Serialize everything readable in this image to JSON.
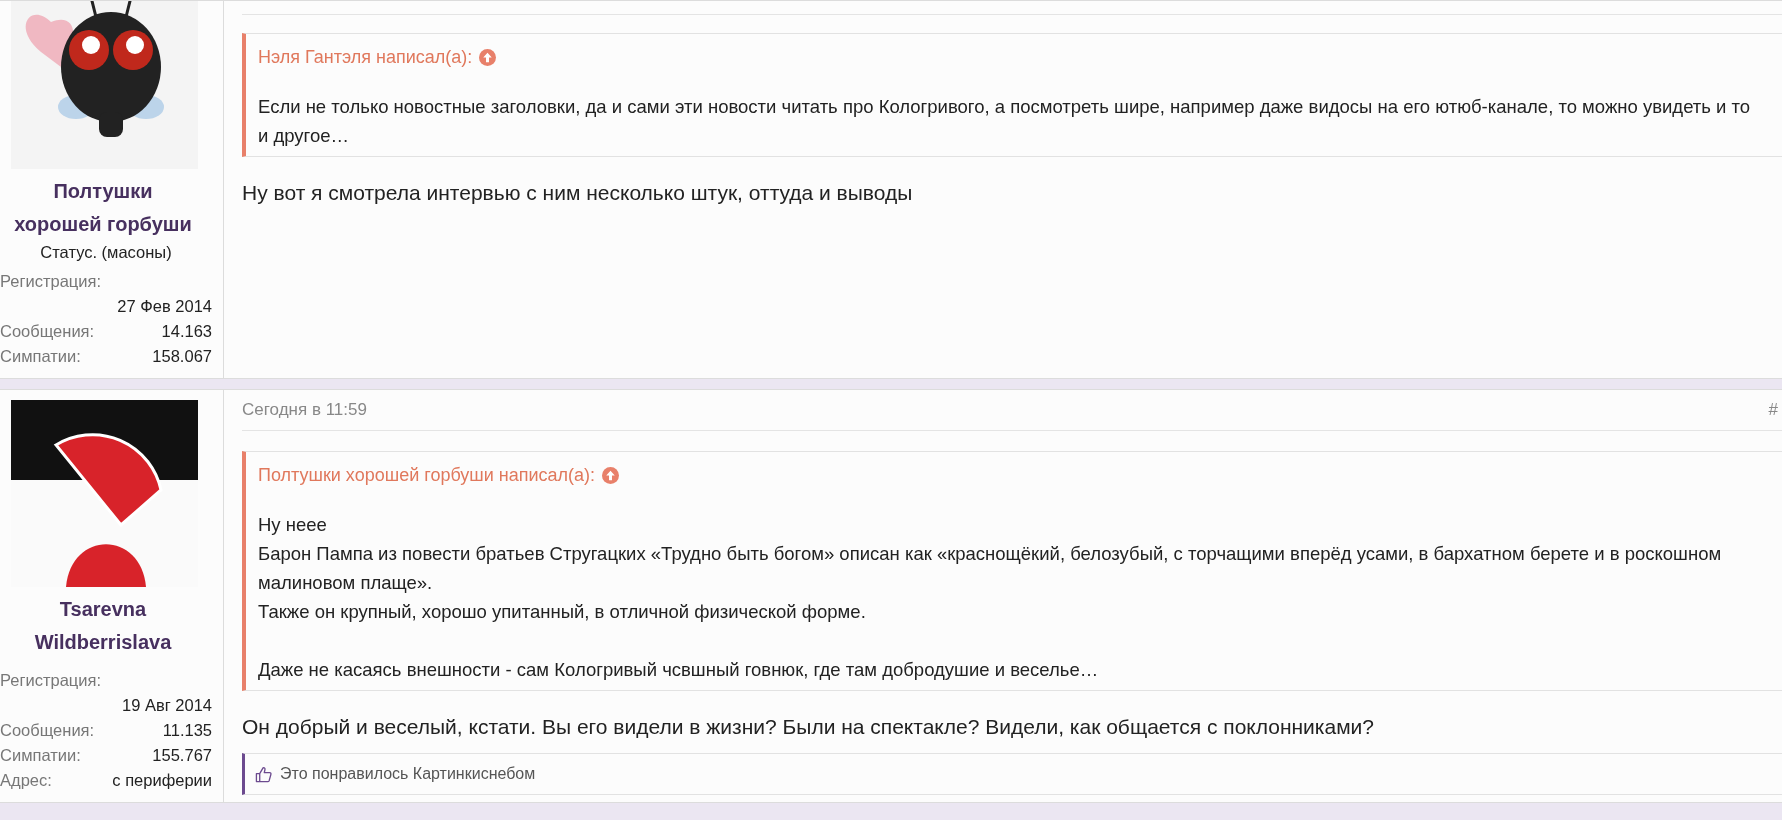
{
  "posts": [
    {
      "author": {
        "name": "Полтушки хорошей горбуши",
        "status": "Статус. (масоны)",
        "avatar": {
          "kind": "insect"
        },
        "stats": [
          {
            "label": "Регистрация:",
            "value": "27 Фев 2014",
            "kind": "stacked"
          },
          {
            "label": "Сообщения:",
            "value": "14.163",
            "kind": "inline"
          },
          {
            "label": "Симпатии:",
            "value": "158.067",
            "kind": "inline"
          }
        ]
      },
      "quote": {
        "author_line": "Нэля Гантэля написал(а):",
        "paragraphs": [
          [
            "Если не только новостные заголовки, да и сами эти новости читать про Кологривого, а посмотреть шире, например даже видосы на его ютюб-канале, то можно увидеть и то и другое…"
          ]
        ]
      },
      "body": "Ну вот я смотрела интервью с ним несколько штук, оттуда и выводы"
    },
    {
      "author": {
        "name": "Tsarevna Wildberrislava",
        "avatar": {
          "kind": "illustration"
        },
        "stats": [
          {
            "label": "Регистрация:",
            "value": "19 Авг 2014",
            "kind": "stacked"
          },
          {
            "label": "Сообщения:",
            "value": "11.135",
            "kind": "inline"
          },
          {
            "label": "Симпатии:",
            "value": "155.767",
            "kind": "inline"
          },
          {
            "label": "Адрес:",
            "value": "с периферии",
            "kind": "inline"
          }
        ]
      },
      "date": "Сегодня в 11:59",
      "permalink": "#",
      "quote": {
        "author_line": "Полтушки хорошей горбуши написал(а):",
        "paragraphs": [
          [
            "Ну неее",
            "Барон Пампа из повести братьев Стругацких «Трудно быть богом» описан как «краснощёкий, белозубый, с торчащими вперёд усами, в бархатном берете и в роскошном малиновом плаще».",
            "Также он крупный, хорошо упитанный, в отличной физической форме."
          ],
          [
            "Даже не касаясь внешности - сам Кологривый чсвшный говнюк, где там добродушие и веселье…"
          ]
        ]
      },
      "body": "Он добрый и веселый, кстати. Вы его видели в жизни? Были на спектакле? Видели, как общается с поклонниками?",
      "likes": "Это понравилось Картинкиснебом"
    }
  ]
}
